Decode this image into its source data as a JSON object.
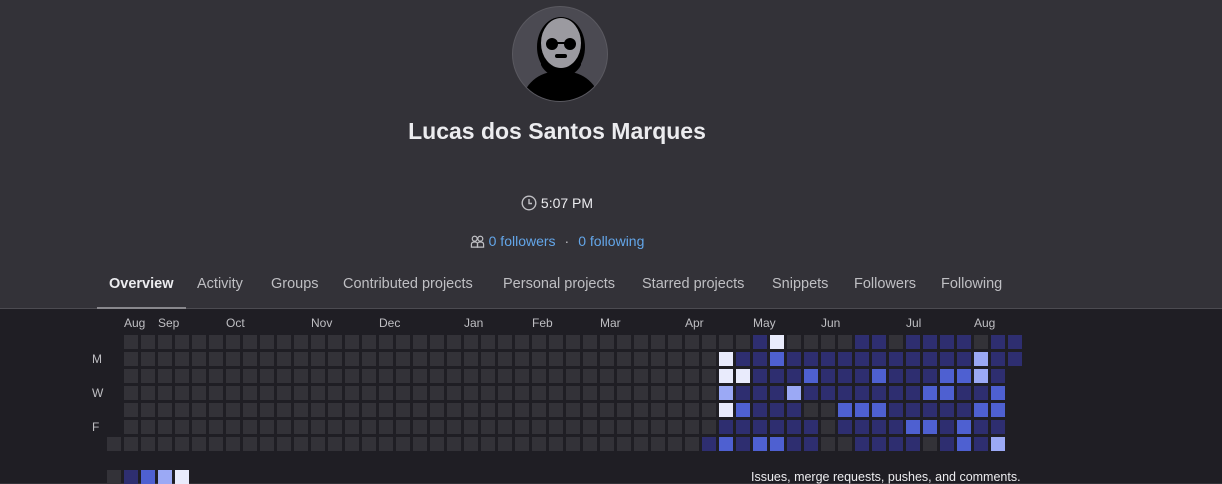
{
  "profile": {
    "name": "Lucas dos Santos Marques",
    "local_time": "5:07 PM",
    "followers": "0 followers",
    "separator": "·",
    "following": "0 following"
  },
  "tabs": [
    {
      "label": "Overview",
      "active": true
    },
    {
      "label": "Activity",
      "active": false
    },
    {
      "label": "Groups",
      "active": false
    },
    {
      "label": "Contributed projects",
      "active": false
    },
    {
      "label": "Personal projects",
      "active": false
    },
    {
      "label": "Starred projects",
      "active": false
    },
    {
      "label": "Snippets",
      "active": false
    },
    {
      "label": "Followers",
      "active": false
    },
    {
      "label": "Following",
      "active": false
    }
  ],
  "calendar": {
    "months": [
      "Aug",
      "Sep",
      "Oct",
      "Nov",
      "Dec",
      "Jan",
      "Feb",
      "Mar",
      "Apr",
      "May",
      "Jun",
      "Jul",
      "Aug"
    ],
    "days": [
      "M",
      "W",
      "F"
    ],
    "levels_colors": [
      "#333238",
      "#2e2e70",
      "#4e60d1",
      "#9ba9f5",
      "#e9ebfc"
    ],
    "legend_levels": [
      0,
      1,
      2,
      3,
      4
    ],
    "weeks": [
      [
        null,
        null,
        null,
        null,
        null,
        null,
        0
      ],
      [
        0,
        0,
        0,
        0,
        0,
        0,
        0
      ],
      [
        0,
        0,
        0,
        0,
        0,
        0,
        0
      ],
      [
        0,
        0,
        0,
        0,
        0,
        0,
        0
      ],
      [
        0,
        0,
        0,
        0,
        0,
        0,
        0
      ],
      [
        0,
        0,
        0,
        0,
        0,
        0,
        0
      ],
      [
        0,
        0,
        0,
        0,
        0,
        0,
        0
      ],
      [
        0,
        0,
        0,
        0,
        0,
        0,
        0
      ],
      [
        0,
        0,
        0,
        0,
        0,
        0,
        0
      ],
      [
        0,
        0,
        0,
        0,
        0,
        0,
        0
      ],
      [
        0,
        0,
        0,
        0,
        0,
        0,
        0
      ],
      [
        0,
        0,
        0,
        0,
        0,
        0,
        0
      ],
      [
        0,
        0,
        0,
        0,
        0,
        0,
        0
      ],
      [
        0,
        0,
        0,
        0,
        0,
        0,
        0
      ],
      [
        0,
        0,
        0,
        0,
        0,
        0,
        0
      ],
      [
        0,
        0,
        0,
        0,
        0,
        0,
        0
      ],
      [
        0,
        0,
        0,
        0,
        0,
        0,
        0
      ],
      [
        0,
        0,
        0,
        0,
        0,
        0,
        0
      ],
      [
        0,
        0,
        0,
        0,
        0,
        0,
        0
      ],
      [
        0,
        0,
        0,
        0,
        0,
        0,
        0
      ],
      [
        0,
        0,
        0,
        0,
        0,
        0,
        0
      ],
      [
        0,
        0,
        0,
        0,
        0,
        0,
        0
      ],
      [
        0,
        0,
        0,
        0,
        0,
        0,
        0
      ],
      [
        0,
        0,
        0,
        0,
        0,
        0,
        0
      ],
      [
        0,
        0,
        0,
        0,
        0,
        0,
        0
      ],
      [
        0,
        0,
        0,
        0,
        0,
        0,
        0
      ],
      [
        0,
        0,
        0,
        0,
        0,
        0,
        0
      ],
      [
        0,
        0,
        0,
        0,
        0,
        0,
        0
      ],
      [
        0,
        0,
        0,
        0,
        0,
        0,
        0
      ],
      [
        0,
        0,
        0,
        0,
        0,
        0,
        0
      ],
      [
        0,
        0,
        0,
        0,
        0,
        0,
        0
      ],
      [
        0,
        0,
        0,
        0,
        0,
        0,
        0
      ],
      [
        0,
        0,
        0,
        0,
        0,
        0,
        0
      ],
      [
        0,
        0,
        0,
        0,
        0,
        0,
        0
      ],
      [
        0,
        0,
        0,
        0,
        0,
        0,
        0
      ],
      [
        0,
        0,
        0,
        0,
        0,
        0,
        1
      ],
      [
        0,
        4,
        4,
        3,
        4,
        1,
        2
      ],
      [
        0,
        1,
        4,
        1,
        2,
        1,
        1
      ],
      [
        1,
        1,
        1,
        1,
        1,
        1,
        2
      ],
      [
        4,
        2,
        1,
        1,
        1,
        1,
        2
      ],
      [
        0,
        1,
        1,
        3,
        1,
        1,
        1
      ],
      [
        0,
        1,
        2,
        1,
        0,
        1,
        1
      ],
      [
        0,
        1,
        1,
        1,
        0,
        0,
        0
      ],
      [
        0,
        1,
        1,
        1,
        2,
        1,
        0
      ],
      [
        1,
        1,
        1,
        1,
        2,
        1,
        1
      ],
      [
        1,
        1,
        2,
        1,
        2,
        1,
        1
      ],
      [
        0,
        1,
        1,
        1,
        1,
        1,
        1
      ],
      [
        1,
        1,
        1,
        1,
        1,
        2,
        1
      ],
      [
        1,
        1,
        1,
        2,
        1,
        2,
        0
      ],
      [
        1,
        1,
        2,
        2,
        1,
        1,
        1
      ],
      [
        1,
        1,
        2,
        1,
        1,
        2,
        2
      ],
      [
        0,
        3,
        3,
        1,
        2,
        1,
        1
      ],
      [
        1,
        1,
        1,
        2,
        2,
        1,
        3
      ],
      [
        1,
        1,
        null,
        null,
        null,
        null,
        null
      ]
    ],
    "legend_text": "Issues, merge requests, pushes, and comments."
  }
}
